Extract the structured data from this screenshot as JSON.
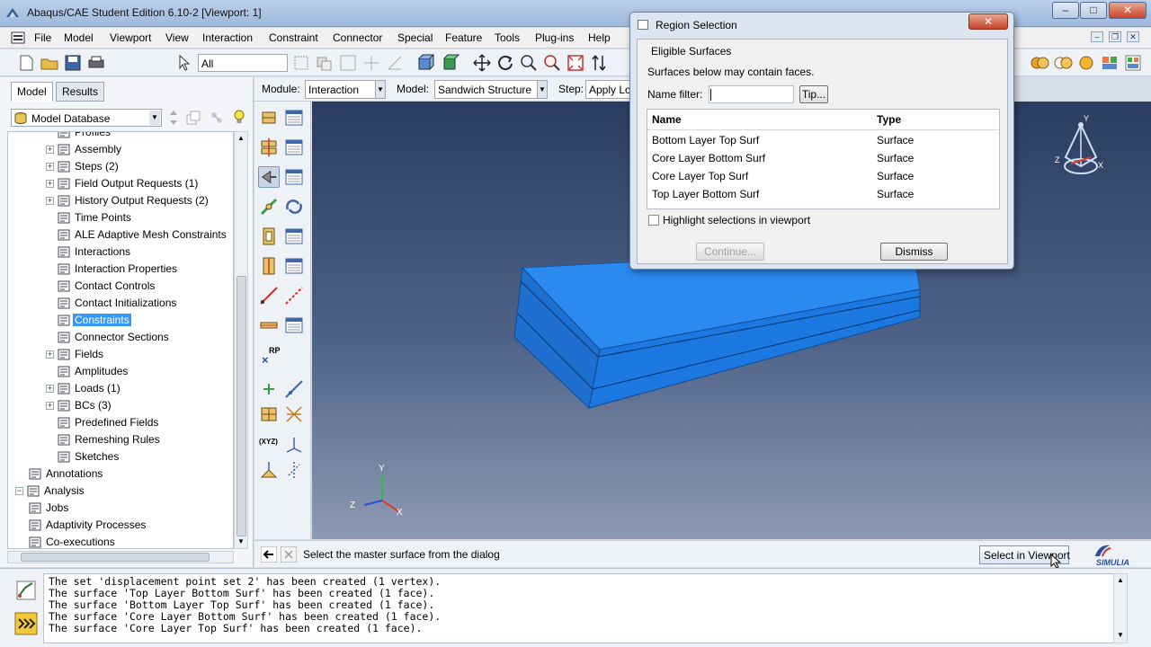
{
  "window": {
    "title": "Abaqus/CAE Student Edition 6.10-2 [Viewport: 1]",
    "controls": {
      "minimize": "–",
      "maximize": "□",
      "close": "✕"
    }
  },
  "menubar": {
    "items": [
      "File",
      "Model",
      "Viewport",
      "View",
      "Interaction",
      "Constraint",
      "Connector",
      "Special",
      "Feature",
      "Tools",
      "Plug-ins",
      "Help"
    ]
  },
  "toolbar": {
    "selection_filter": "All"
  },
  "left_panel": {
    "tabs": [
      "Model",
      "Results"
    ],
    "database_select": "Model Database",
    "tree": [
      {
        "label": "Profiles",
        "indent": 2,
        "expandable": false
      },
      {
        "label": "Assembly",
        "indent": 2,
        "expandable": true
      },
      {
        "label": "Steps (2)",
        "indent": 2,
        "expandable": true
      },
      {
        "label": "Field Output Requests (1)",
        "indent": 2,
        "expandable": true
      },
      {
        "label": "History Output Requests (2)",
        "indent": 2,
        "expandable": true
      },
      {
        "label": "Time Points",
        "indent": 2,
        "expandable": false
      },
      {
        "label": "ALE Adaptive Mesh Constraints",
        "indent": 2,
        "expandable": false
      },
      {
        "label": "Interactions",
        "indent": 2,
        "expandable": false
      },
      {
        "label": "Interaction Properties",
        "indent": 2,
        "expandable": false
      },
      {
        "label": "Contact Controls",
        "indent": 2,
        "expandable": false
      },
      {
        "label": "Contact Initializations",
        "indent": 2,
        "expandable": false
      },
      {
        "label": "Constraints",
        "indent": 2,
        "expandable": false,
        "selected": true
      },
      {
        "label": "Connector Sections",
        "indent": 2,
        "expandable": false
      },
      {
        "label": "Fields",
        "indent": 2,
        "expandable": true
      },
      {
        "label": "Amplitudes",
        "indent": 2,
        "expandable": false
      },
      {
        "label": "Loads (1)",
        "indent": 2,
        "expandable": true
      },
      {
        "label": "BCs (3)",
        "indent": 2,
        "expandable": true
      },
      {
        "label": "Predefined Fields",
        "indent": 2,
        "expandable": false
      },
      {
        "label": "Remeshing Rules",
        "indent": 2,
        "expandable": false
      },
      {
        "label": "Sketches",
        "indent": 2,
        "expandable": false
      },
      {
        "label": "Annotations",
        "indent": 1,
        "expandable": false
      },
      {
        "label": "Analysis",
        "indent": 0,
        "expandable": true,
        "expanded": true
      },
      {
        "label": "Jobs",
        "indent": 1,
        "expandable": false
      },
      {
        "label": "Adaptivity Processes",
        "indent": 1,
        "expandable": false
      },
      {
        "label": "Co-executions",
        "indent": 1,
        "expandable": false
      }
    ]
  },
  "context_bar": {
    "module_label": "Module:",
    "module_value": "Interaction",
    "model_label": "Model:",
    "model_value": "Sandwich Structure",
    "step_label": "Step:",
    "step_value": "Apply Lo"
  },
  "toolbox": {
    "rp_label": "RP",
    "xyz_label": "(XYZ)"
  },
  "viewport": {
    "triad_small": {
      "y": "Y",
      "x": "X",
      "z": "Z"
    },
    "triad_large": {
      "y": "Y",
      "x": "X",
      "z": "Z"
    },
    "part_color": "#1a78e0"
  },
  "prompt_bar": {
    "prompt_text": "Select the master surface from the dialog",
    "select_in_viewport": "Select in Viewport",
    "logo_text": "SIMULIA"
  },
  "messages": [
    "The set 'displacement point set 2' has been created (1 vertex).",
    "The surface 'Top Layer Bottom Surf' has been created (1 face).",
    "The surface 'Bottom Layer Top Surf' has been created (1 face).",
    "The surface 'Core Layer Bottom Surf' has been created (1 face).",
    "The surface 'Core Layer Top Surf' has been created (1 face)."
  ],
  "dialog": {
    "title": "Region Selection",
    "close": "✕",
    "section_title": "Eligible Surfaces",
    "description": "Surfaces below may contain faces.",
    "name_filter_label": "Name filter:",
    "name_filter_value": "",
    "tip_button": "Tip...",
    "columns": [
      "Name",
      "Type"
    ],
    "rows": [
      {
        "name": "Bottom Layer Top Surf",
        "type": "Surface"
      },
      {
        "name": "Core Layer Bottom Surf",
        "type": "Surface"
      },
      {
        "name": "Core Layer Top Surf",
        "type": "Surface"
      },
      {
        "name": "Top Layer Bottom Surf",
        "type": "Surface"
      }
    ],
    "highlight_label": "Highlight selections in viewport",
    "continue_button": "Continue...",
    "dismiss_button": "Dismiss"
  }
}
